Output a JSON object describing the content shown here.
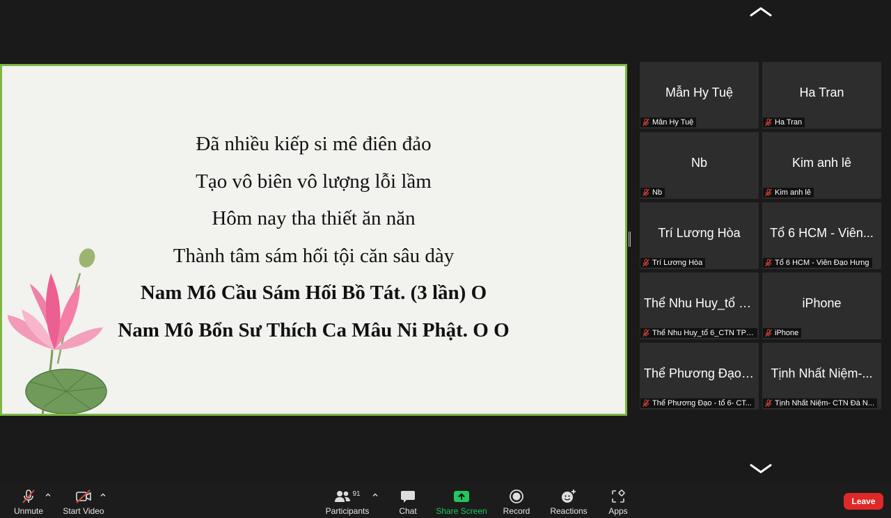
{
  "shared_slide": {
    "verses": [
      {
        "text": "Đã nhiều kiếp si mê điên đảo",
        "bold": false
      },
      {
        "text": "Tạo vô biên vô lượng lỗi lầm",
        "bold": false
      },
      {
        "text": "Hôm nay tha thiết ăn năn",
        "bold": false
      },
      {
        "text": "Thành tâm sám hối tội căn sâu dày",
        "bold": false
      },
      {
        "text": "Nam Mô Cầu Sám Hối Bồ Tát. (3 lần) O",
        "bold": true
      },
      {
        "text": "Nam Mô Bổn Sư Thích Ca Mâu Ni Phật. O O",
        "bold": true
      }
    ],
    "border_color": "#7cb742"
  },
  "participants": [
    {
      "name": "Mẫn Hy Tuệ",
      "label": "Mẫn Hy Tuệ",
      "muted": true
    },
    {
      "name": "Ha Tran",
      "label": "Ha Tran",
      "muted": true
    },
    {
      "name": "Nb",
      "label": "Nb",
      "muted": true
    },
    {
      "name": "Kim anh lê",
      "label": "Kim anh lê",
      "muted": true
    },
    {
      "name": "Trí Lương Hòa",
      "label": "Trí Lương Hòa",
      "muted": true
    },
    {
      "name": "Tổ 6 HCM - Viên...",
      "label": "Tổ 6 HCM - Viên Đạo Hưng",
      "muted": true
    },
    {
      "name": "Thể Nhu Huy_tổ 6...",
      "label": "Thể Nhu Huy_tổ 6_CTN TPH...",
      "muted": true
    },
    {
      "name": "iPhone",
      "label": "iPhone",
      "muted": true
    },
    {
      "name": "Thể Phương Đạo -...",
      "label": "Thể Phương Đạo -  tổ 6- CT...",
      "muted": true
    },
    {
      "name": "Tịnh Nhất Niệm-...",
      "label": "Tịnh Nhất Niệm- CTN Đà N...",
      "muted": true
    }
  ],
  "toolbar": {
    "unmute": "Unmute",
    "start_video": "Start Video",
    "participants": "Participants",
    "participants_count": "91",
    "chat": "Chat",
    "share_screen": "Share Screen",
    "record": "Record",
    "reactions": "Reactions",
    "apps": "Apps",
    "leave": "Leave"
  },
  "colors": {
    "muted_red": "#e0443e",
    "share_green": "#22c55e",
    "leave_red": "#e02828"
  },
  "icons": [
    "chevron-up-icon",
    "chevron-down-icon",
    "mic-muted-icon",
    "video-off-icon",
    "participants-icon",
    "chat-icon",
    "share-screen-icon",
    "record-icon",
    "reactions-icon",
    "apps-icon"
  ]
}
